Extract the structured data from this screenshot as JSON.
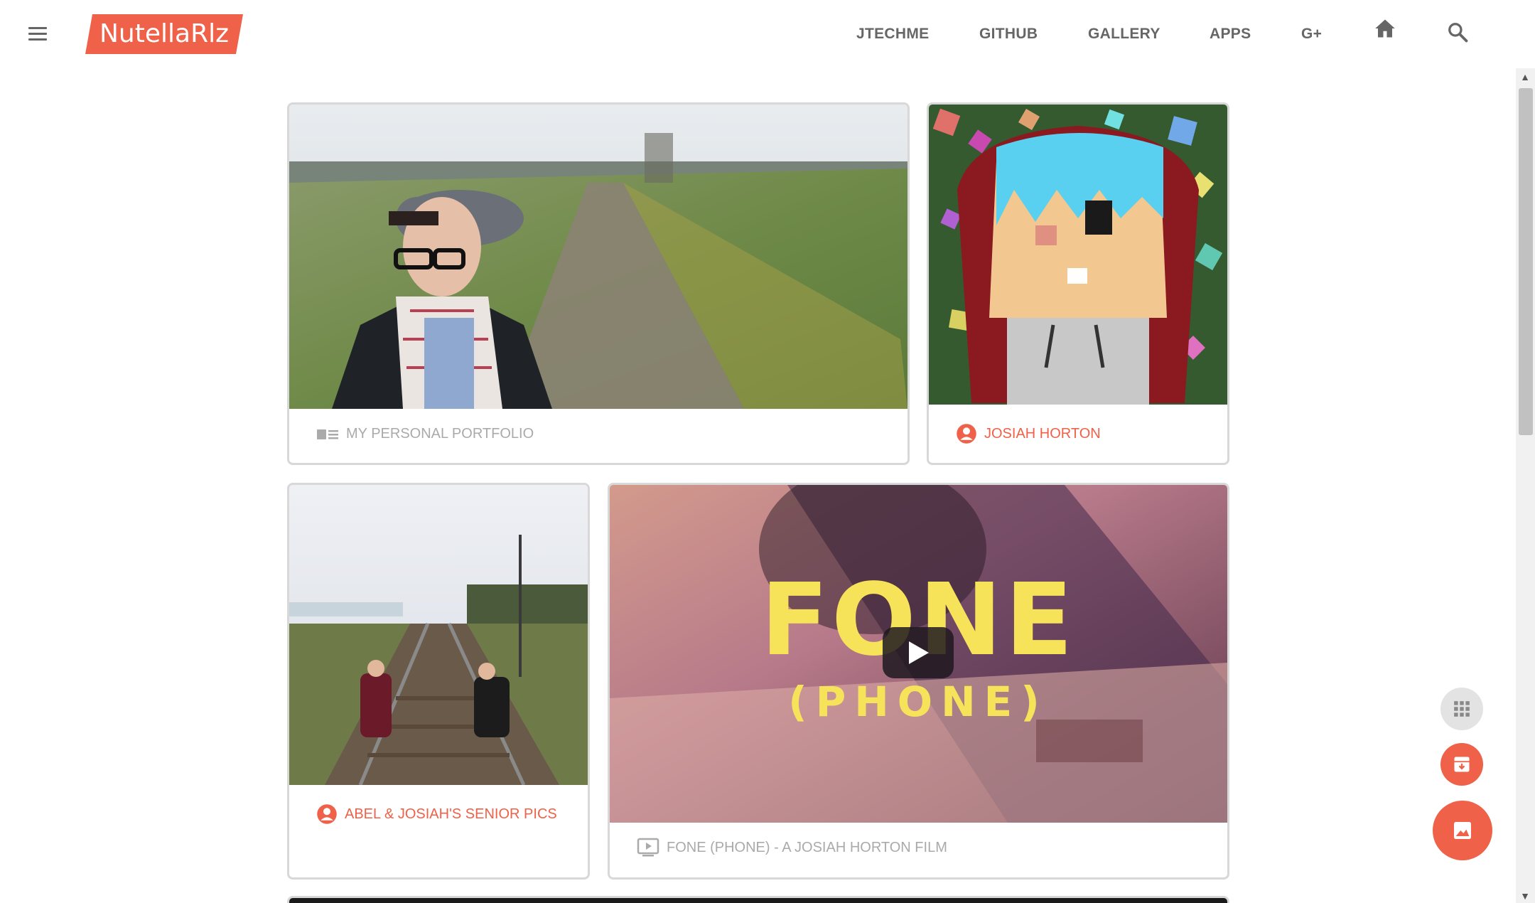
{
  "header": {
    "logo": "NutellaRlz",
    "nav": [
      "JTECHME",
      "GITHUB",
      "GALLERY",
      "APPS",
      "G+"
    ]
  },
  "cards": {
    "portfolio": {
      "caption": "MY PERSONAL PORTFOLIO",
      "icon": "contact-card-icon"
    },
    "josiah": {
      "caption": "JOSIAH HORTON",
      "icon": "account-circle-icon"
    },
    "senior": {
      "caption": "ABEL & JOSIAH'S SENIOR PICS",
      "icon": "account-circle-icon"
    },
    "fone": {
      "caption": "FONE (PHONE) - A JOSIAH HORTON FILM",
      "icon": "video-icon",
      "title_main": "FONE",
      "title_sub": "(PHONE)"
    }
  },
  "colors": {
    "accent": "#ef6148",
    "muted": "#aaaaaa",
    "nav": "#666666"
  },
  "fabs": [
    "apps-grid-icon",
    "archive-icon",
    "image-icon"
  ]
}
